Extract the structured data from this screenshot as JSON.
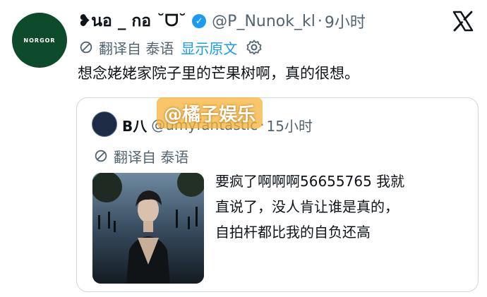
{
  "author": {
    "avatar_text": "NORGOR",
    "display_name": "❥นอ _ กอ ˘ᗜ˘",
    "handle": "@P_Nunok_kl",
    "separator": "·",
    "time": "9小时"
  },
  "translation": {
    "label": "翻译自 泰语",
    "show_original": "显示原文"
  },
  "tweet": {
    "text": "想念姥姥家院子里的芒果树啊，真的很想。"
  },
  "quote": {
    "name": "B八",
    "handle": "@umyfantastic",
    "separator": "·",
    "time": "15小时",
    "translation_label": "翻译自 泰语",
    "text_lines": [
      "要疯了啊啊啊56655765 我就",
      "直说了，没人肯让谁是真的，",
      "自拍杆都比我的自负还高"
    ]
  },
  "watermark": {
    "text": "@橘子娱乐"
  },
  "colors": {
    "accent": "#1d9bf0",
    "secondary_text": "#536471",
    "avatar_bg": "#0e4a2c"
  },
  "icons": [
    "verified-badge-icon",
    "x-logo-icon",
    "translate-icon",
    "gear-icon"
  ]
}
